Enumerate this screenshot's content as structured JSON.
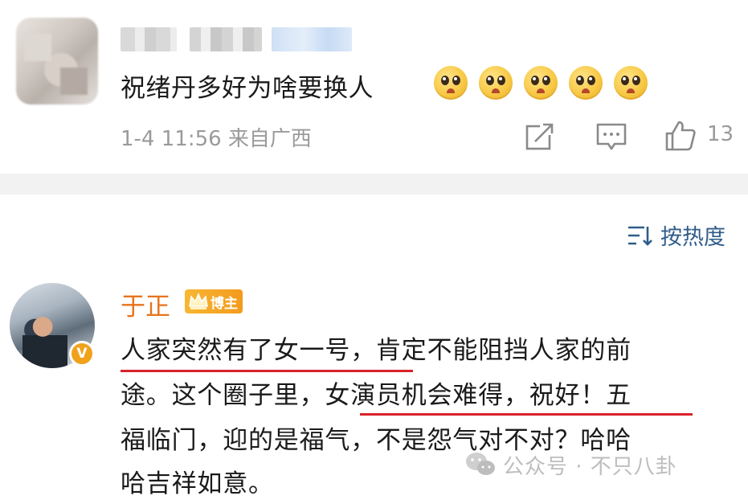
{
  "comment1": {
    "text": "祝绪丹多好为啥要换人",
    "emoji_count": 5,
    "meta": "1-4 11:56 来自广西",
    "like_count": "13",
    "icons": [
      "share-icon",
      "comment-icon",
      "like-icon"
    ]
  },
  "sort": {
    "label": "按热度",
    "icon": "sort-icon"
  },
  "comment2": {
    "author": "于正",
    "badge": "博主",
    "verified_mark": "V",
    "lines": [
      "人家突然有了女一号，肯定不能阻挡人家的前",
      "途。这个圈子里，女演员机会难得，祝好！五",
      "福临门，迎的是福气，不是怨气对不对？哈哈",
      "哈吉祥如意。"
    ],
    "underline_color": "#d9222a"
  },
  "watermark": {
    "text": "公众号 · 不只八卦"
  },
  "colors": {
    "author": "#e8731c",
    "link": "#2f5d8a",
    "meta": "#9a9a9a",
    "badge": "#f39a1c"
  }
}
